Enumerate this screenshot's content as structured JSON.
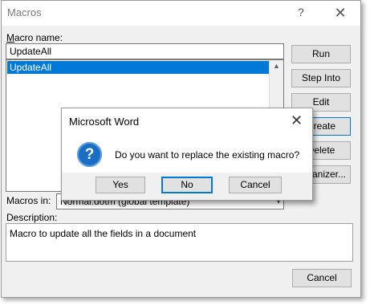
{
  "window": {
    "title": "Macros",
    "help_glyph": "?",
    "close_glyph": "✕"
  },
  "macro_name": {
    "label": "Macro name:",
    "value": "UpdateAll",
    "list_items": [
      "UpdateAll"
    ],
    "selected_index": 0
  },
  "buttons": {
    "run": "Run",
    "step_into": "Step Into",
    "edit": "Edit",
    "create": "Create",
    "delete": "Delete",
    "organizer": "Organizer...",
    "cancel": "Cancel"
  },
  "macros_in": {
    "label": "Macros in:",
    "value": "Normal.dotm (global template)",
    "arrow_glyph": "▾"
  },
  "description": {
    "label": "Description:",
    "value": "Macro to update all the fields in a document"
  },
  "modal": {
    "title": "Microsoft Word",
    "close_glyph": "✕",
    "icon_glyph": "?",
    "message": "Do you want to replace the existing macro?",
    "yes": "Yes",
    "no": "No",
    "cancel": "Cancel"
  },
  "colors": {
    "accent": "#0078d7",
    "question_icon": "#1a6fc4"
  }
}
